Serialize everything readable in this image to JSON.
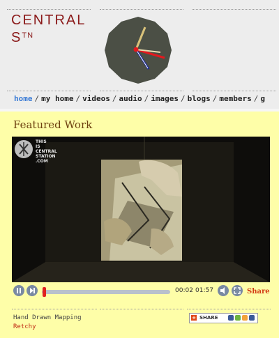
{
  "header": {
    "logo_line1": "CENTRAL",
    "logo_line2": "S",
    "logo_line2_sup": "TN"
  },
  "nav": {
    "items": [
      {
        "label": "home",
        "active": true
      },
      {
        "label": "my home"
      },
      {
        "label": "videos"
      },
      {
        "label": "audio"
      },
      {
        "label": "images"
      },
      {
        "label": "blogs"
      },
      {
        "label": "members"
      },
      {
        "label": "g"
      }
    ],
    "separator": "/"
  },
  "featured": {
    "title": "Featured Work",
    "video": {
      "watermark_lines": [
        "THIS",
        "IS",
        "CENTRAL",
        "STATION",
        ".COM"
      ],
      "progress_fraction": 0.018,
      "time_current": "00:02",
      "time_total": "01:57",
      "share_label": "Share"
    },
    "work_title": "Hand Drawn Mapping",
    "work_author": "Retchy",
    "share_widget_label": "SHARE"
  },
  "colors": {
    "logo": "#8b1a1a",
    "nav_active": "#3a7bd5",
    "featured_bg": "#fefea8",
    "featured_title": "#6e4210",
    "share": "#d33c13",
    "author": "#c02a12",
    "progress_handle": "#e02020"
  }
}
